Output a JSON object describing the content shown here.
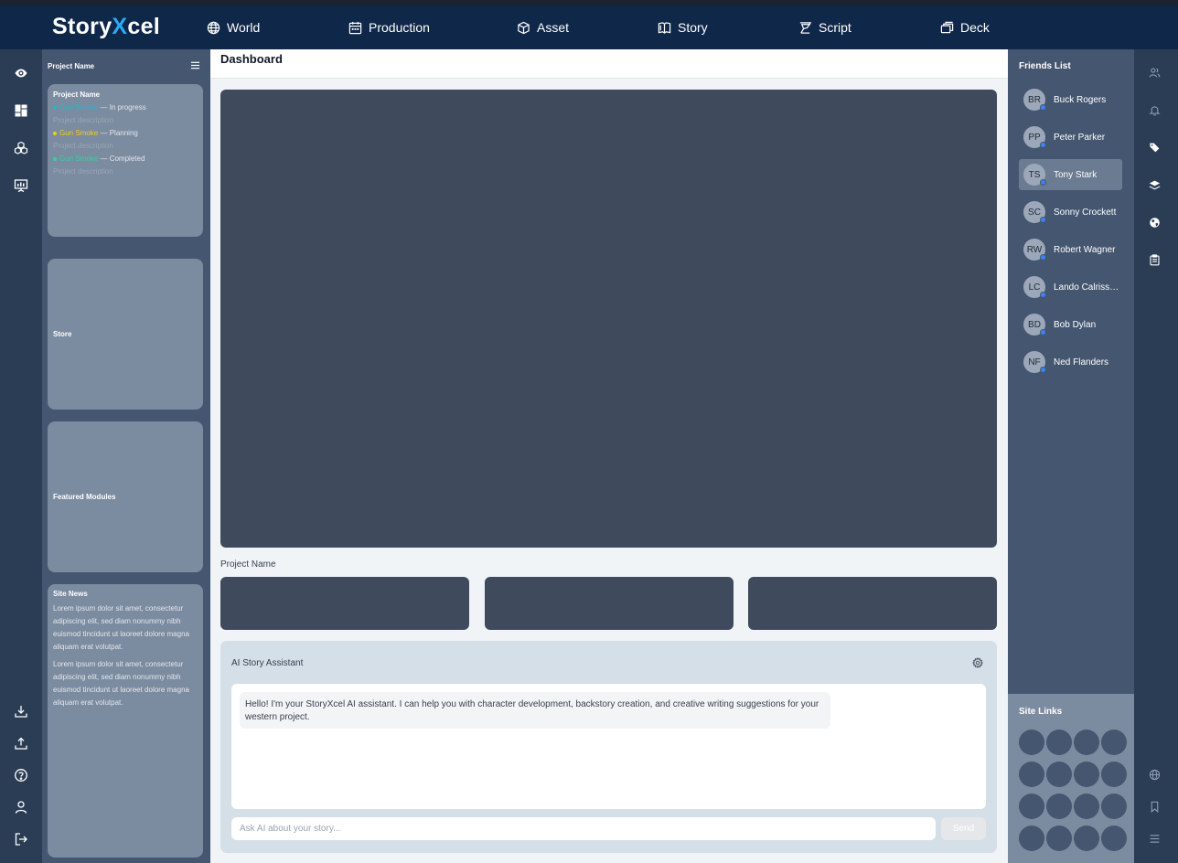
{
  "app": {
    "logo_part1": "Story",
    "logo_x": "X",
    "logo_part2": "cel",
    "nav": [
      {
        "label": "World",
        "icon": "globe-icon"
      },
      {
        "label": "Production",
        "icon": "calendar-icon"
      },
      {
        "label": "Asset",
        "icon": "cube-icon"
      },
      {
        "label": "Story",
        "icon": "book-icon"
      },
      {
        "label": "Script",
        "icon": "quill-icon"
      },
      {
        "label": "Deck",
        "icon": "cards-icon"
      }
    ]
  },
  "left_rail": {
    "top_icons": [
      "eye-icon",
      "dashboard-icon",
      "modules-icon",
      "presentation-icon"
    ],
    "bottom_icons": [
      "download-icon",
      "upload-icon",
      "help-icon",
      "user-icon",
      "logout-icon"
    ]
  },
  "left_panel": {
    "title": "Project Name",
    "project_card": {
      "title": "Project Name",
      "projects": [
        {
          "name": "Gun Smoke",
          "status": "— In progress",
          "description": "Project description",
          "color": "#22b8cf"
        },
        {
          "name": "Gun Smoke",
          "status": "— Planning",
          "description": "Project description",
          "color": "#facc15"
        },
        {
          "name": "Gun Smoke",
          "status": "— Completed",
          "description": "Project description",
          "color": "#34d399"
        }
      ]
    },
    "store_title": "Store",
    "featured_title": "Featured Modules",
    "news": {
      "title": "Site News",
      "paragraphs": [
        "Lorem ipsum dolor sit amet, consectetur adipiscing elit, sed diam nonummy nibh euismod tincidunt ut laoreet dolore magna aliquam erat volutpat.",
        "Lorem ipsum dolor sit amet, consectetur adipiscing elit, sed diam nonummy nibh euismod tincidunt ut laoreet dolore magna aliquam erat volutpat."
      ]
    }
  },
  "main": {
    "title": "Dashboard",
    "project_label": "Project Name",
    "ai": {
      "title": "AI Story Assistant",
      "message": "Hello! I'm your StoryXcel AI assistant. I can help you with character development, backstory creation, and creative writing suggestions for your western project.",
      "placeholder": "Ask AI about your story...",
      "send_label": "Send"
    }
  },
  "friends": {
    "title": "Friends List",
    "list": [
      {
        "initials": "BR",
        "name": "Buck Rogers"
      },
      {
        "initials": "PP",
        "name": "Peter Parker"
      },
      {
        "initials": "TS",
        "name": "Tony Stark",
        "active": true
      },
      {
        "initials": "SC",
        "name": "Sonny Crockett"
      },
      {
        "initials": "RW",
        "name": "Robert Wagner"
      },
      {
        "initials": "LC",
        "name": "Lando Calrissian"
      },
      {
        "initials": "BD",
        "name": "Bob Dylan"
      },
      {
        "initials": "NF",
        "name": "Ned Flanders"
      }
    ],
    "status_color": "#3b82f6"
  },
  "site_links": {
    "title": "Site Links"
  },
  "right_rail": {
    "top_icons": [
      "users-icon",
      "bell-icon",
      "tags-icon",
      "layers-icon",
      "globe-icon",
      "clipboard-icon"
    ],
    "bottom_icons": [
      "globe-icon",
      "bookmark-icon",
      "menu-icon"
    ]
  },
  "colors": {
    "header": "#0f2748",
    "accent": "#2ca8f2",
    "panel": "#455670",
    "card": "#7b8ba0"
  }
}
